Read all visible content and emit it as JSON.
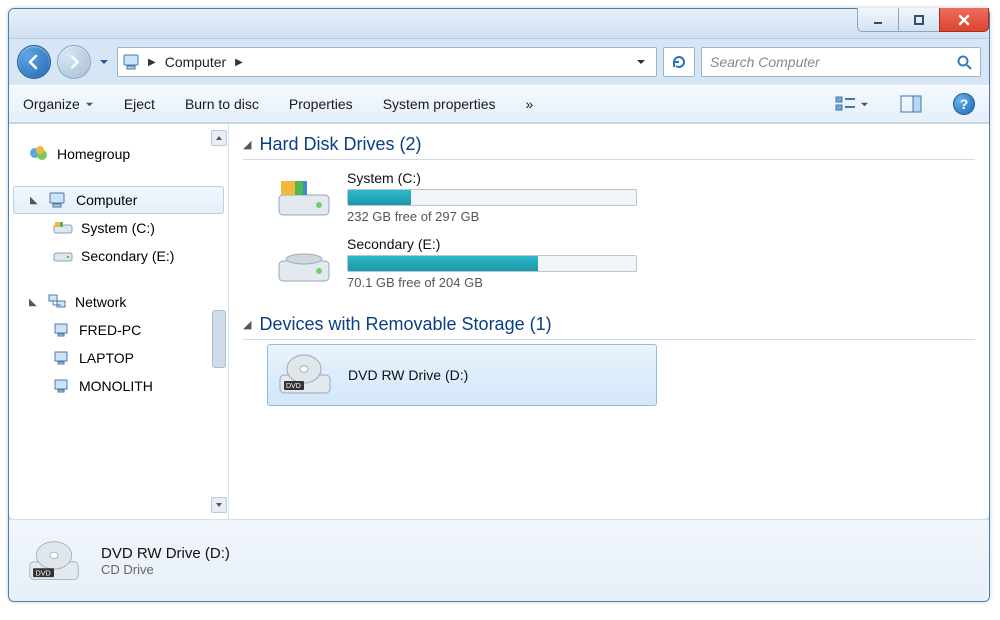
{
  "breadcrumb": {
    "root": "Computer"
  },
  "search": {
    "placeholder": "Search Computer"
  },
  "toolbar": {
    "organize": "Organize",
    "eject": "Eject",
    "burn": "Burn to disc",
    "properties": "Properties",
    "sysprops": "System properties",
    "overflow": "»"
  },
  "nav": {
    "homegroup": "Homegroup",
    "computer": "Computer",
    "drive_c": "System (C:)",
    "drive_e": "Secondary (E:)",
    "network": "Network",
    "pcs": [
      "FRED-PC",
      "LAPTOP",
      "MONOLITH"
    ]
  },
  "categories": {
    "hdd": {
      "title": "Hard Disk Drives (2)"
    },
    "removable": {
      "title": "Devices with Removable Storage (1)"
    }
  },
  "drives": [
    {
      "name": "System (C:)",
      "free": "232 GB free of 297 GB",
      "fill_pct": 22
    },
    {
      "name": "Secondary (E:)",
      "free": "70.1 GB free of 204 GB",
      "fill_pct": 66
    }
  ],
  "dvd": {
    "name": "DVD RW Drive (D:)"
  },
  "details": {
    "title": "DVD RW Drive (D:)",
    "sub": "CD Drive"
  }
}
